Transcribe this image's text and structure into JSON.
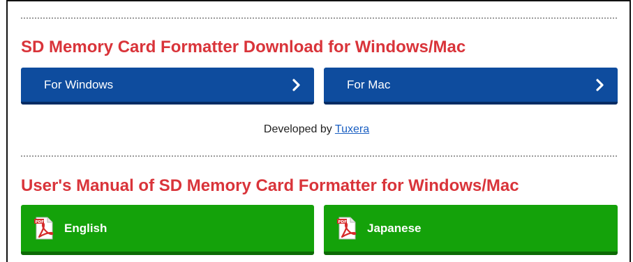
{
  "download_section": {
    "heading": "SD Memory Card Formatter Download for Windows/Mac",
    "heading_color": "#d9343a",
    "buttons": [
      {
        "label": "For Windows",
        "icon": "chevron-right-icon"
      },
      {
        "label": "For Mac",
        "icon": "chevron-right-icon"
      }
    ],
    "button_color": "#0e4c9e",
    "developer_prefix": "Developed by",
    "developer_link": "Tuxera"
  },
  "manual_section": {
    "heading": "User's Manual of SD Memory Card Formatter for Windows/Mac",
    "heading_color": "#d9343a",
    "buttons": [
      {
        "label": "English",
        "icon": "pdf-icon"
      },
      {
        "label": "Japanese",
        "icon": "pdf-icon"
      }
    ],
    "button_color": "#14a20a"
  }
}
